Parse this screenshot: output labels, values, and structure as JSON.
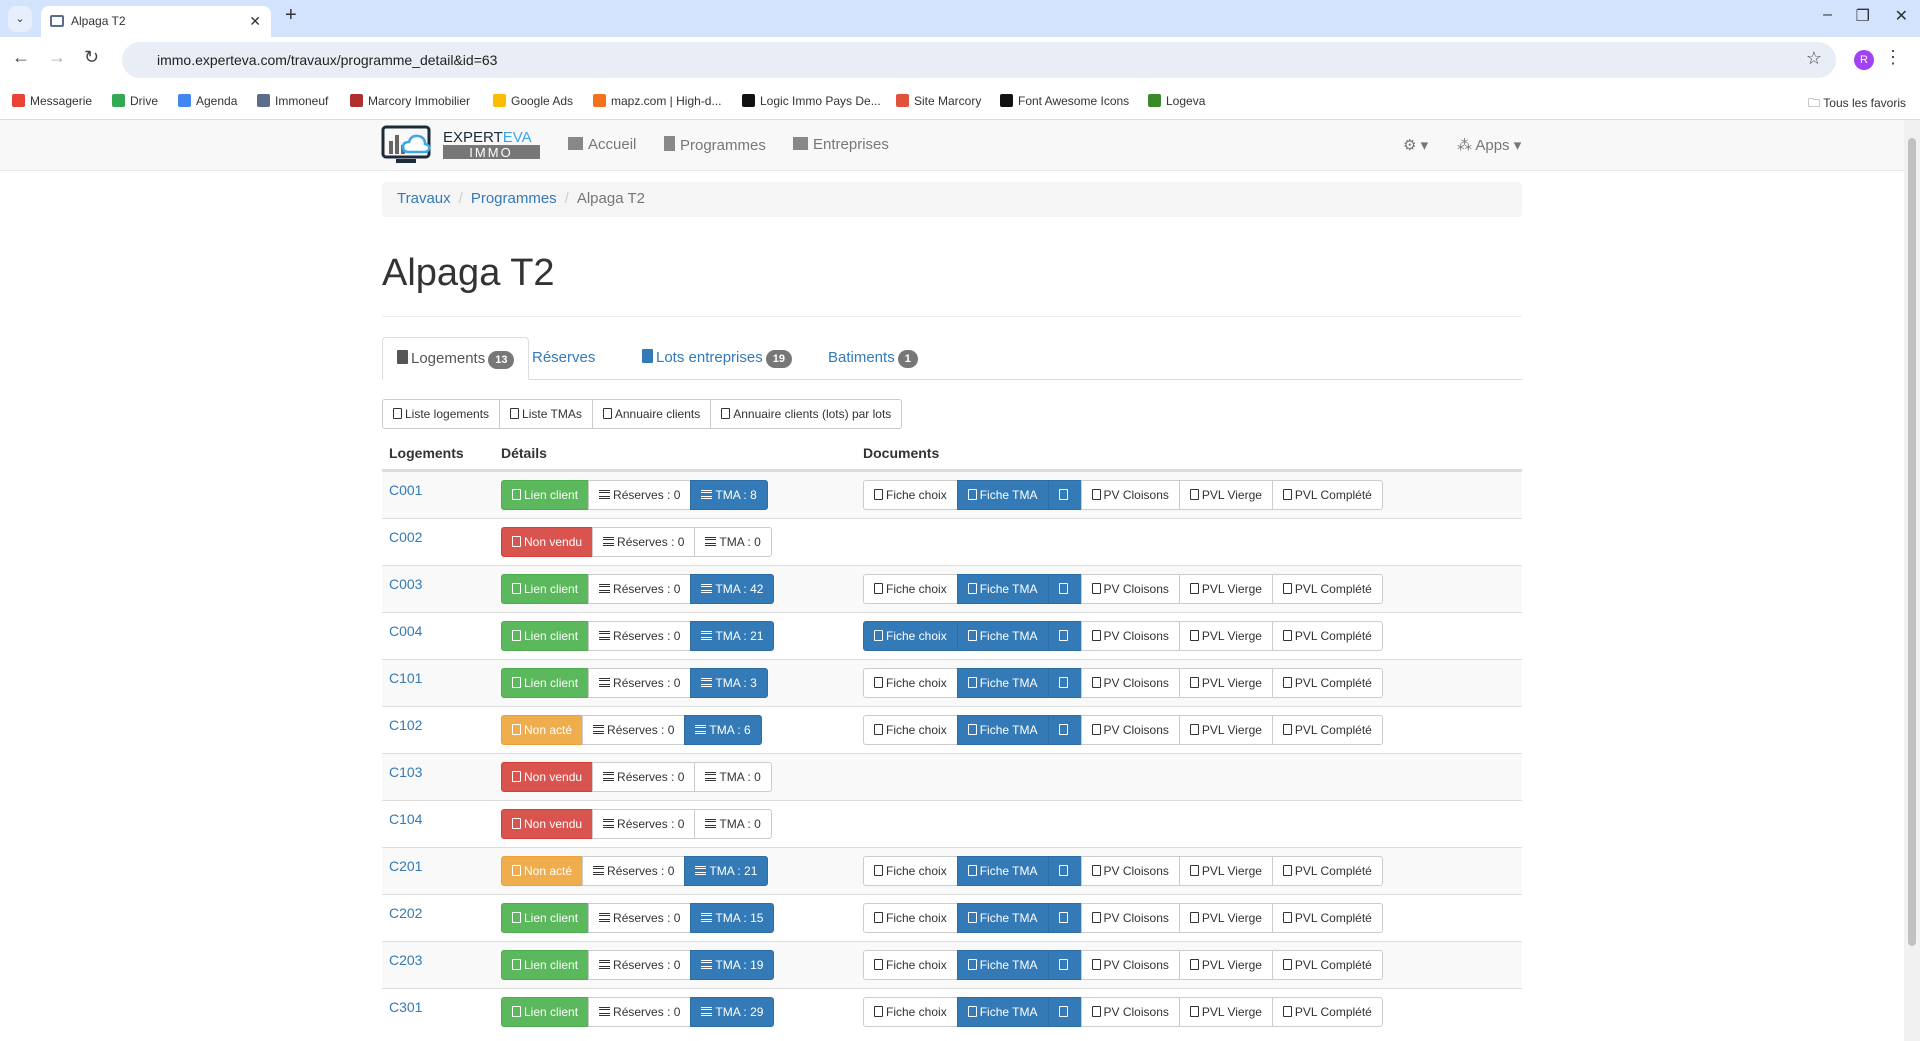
{
  "browser": {
    "tab_title": "Alpaga T2",
    "url": "immo.experteva.com/travaux/programme_detail&id=63",
    "profile_initial": "R",
    "bookmarks": [
      "Messagerie",
      "Drive",
      "Agenda",
      "Immoneuf",
      "Marcory Immobilier",
      "Google Ads",
      "mapz.com | High-d...",
      "Logic Immo Pays De...",
      "Site Marcory",
      "Font Awesome Icons",
      "Logeva"
    ],
    "all_bookmarks": "Tous les favoris"
  },
  "navbar": {
    "logo_text": "EXPERTEVA IMMO",
    "links": [
      "Accueil",
      "Programmes",
      "Entreprises"
    ],
    "apps": "Apps"
  },
  "breadcrumb": [
    "Travaux",
    "Programmes",
    "Alpaga T2"
  ],
  "title": "Alpaga T2",
  "tabs": [
    {
      "label": "Logements",
      "count": "13"
    },
    {
      "label": "Réserves",
      "count": ""
    },
    {
      "label": "Lots entreprises",
      "count": "19"
    },
    {
      "label": "Batiments",
      "count": "1"
    }
  ],
  "exports": [
    "Liste logements",
    "Liste TMAs",
    "Annuaire clients",
    "Annuaire clients (lots) par lots"
  ],
  "table": {
    "headers": [
      "Logements",
      "Détails",
      "Documents"
    ],
    "doc_labels": [
      "Fiche choix",
      "Fiche TMA",
      "",
      "PV Cloisons",
      "PVL Vierge",
      "PVL Complété"
    ],
    "status_labels": {
      "success": "Lien client",
      "danger": "Non vendu",
      "warning": "Non acté"
    },
    "reserves_label": "Réserves : 0",
    "rows": [
      {
        "code": "C001",
        "status": "success",
        "tma": "TMA : 8",
        "docs": true,
        "fiche_choix_primary": false
      },
      {
        "code": "C002",
        "status": "danger",
        "tma": "TMA : 0",
        "docs": false
      },
      {
        "code": "C003",
        "status": "success",
        "tma": "TMA : 42",
        "docs": true,
        "fiche_choix_primary": false
      },
      {
        "code": "C004",
        "status": "success",
        "tma": "TMA : 21",
        "docs": true,
        "fiche_choix_primary": true
      },
      {
        "code": "C101",
        "status": "success",
        "tma": "TMA : 3",
        "docs": true,
        "fiche_choix_primary": false
      },
      {
        "code": "C102",
        "status": "warning",
        "tma": "TMA : 6",
        "docs": true,
        "fiche_choix_primary": false
      },
      {
        "code": "C103",
        "status": "danger",
        "tma": "TMA : 0",
        "docs": false
      },
      {
        "code": "C104",
        "status": "danger",
        "tma": "TMA : 0",
        "docs": false
      },
      {
        "code": "C201",
        "status": "warning",
        "tma": "TMA : 21",
        "docs": true,
        "fiche_choix_primary": false
      },
      {
        "code": "C202",
        "status": "success",
        "tma": "TMA : 15",
        "docs": true,
        "fiche_choix_primary": false
      },
      {
        "code": "C203",
        "status": "success",
        "tma": "TMA : 19",
        "docs": true,
        "fiche_choix_primary": false
      },
      {
        "code": "C301",
        "status": "success",
        "tma": "TMA : 29",
        "docs": true,
        "fiche_choix_primary": false
      }
    ]
  },
  "colors": {
    "primary": "#337ab7",
    "success": "#5cb85c",
    "danger": "#d9534f",
    "warning": "#f0ad4e"
  }
}
